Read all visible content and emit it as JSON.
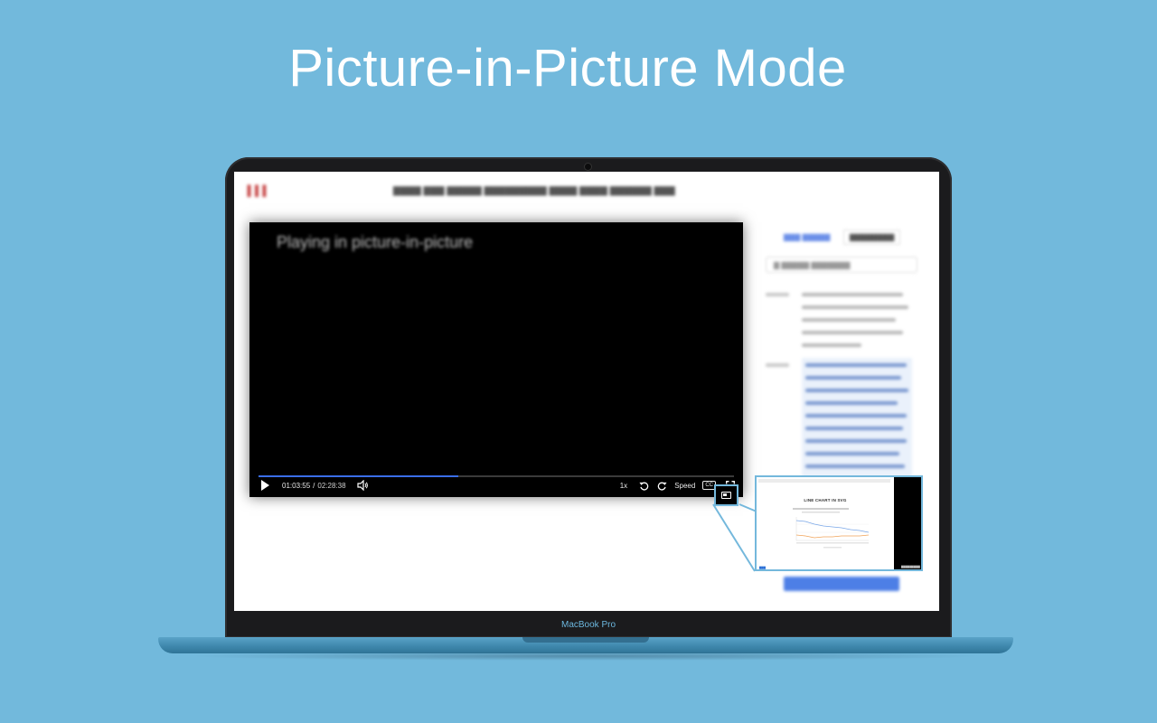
{
  "headline": "Picture-in-Picture Mode",
  "laptop": {
    "model_label": "MacBook Pro"
  },
  "video": {
    "overlay_message": "Playing in picture-in-picture",
    "current_time": "01:03:55",
    "time_separator": "/",
    "duration": "02:28:38",
    "progress": 0.42,
    "playback_rate": "1x",
    "speed_label": "Speed",
    "cc_label": "CC"
  },
  "pip_window": {
    "heading": "LINE CHART IN SVG"
  },
  "icons": {
    "play": "play-icon",
    "volume": "volume-icon",
    "rewind": "rewind-icon",
    "forward": "forward-icon",
    "fullscreen": "fullscreen-icon",
    "pip": "picture-in-picture-icon"
  },
  "colors": {
    "background": "#72b9dc",
    "accent": "#74b8dc",
    "progress": "#3a6ee8",
    "bezel": "#1b1b1d"
  }
}
